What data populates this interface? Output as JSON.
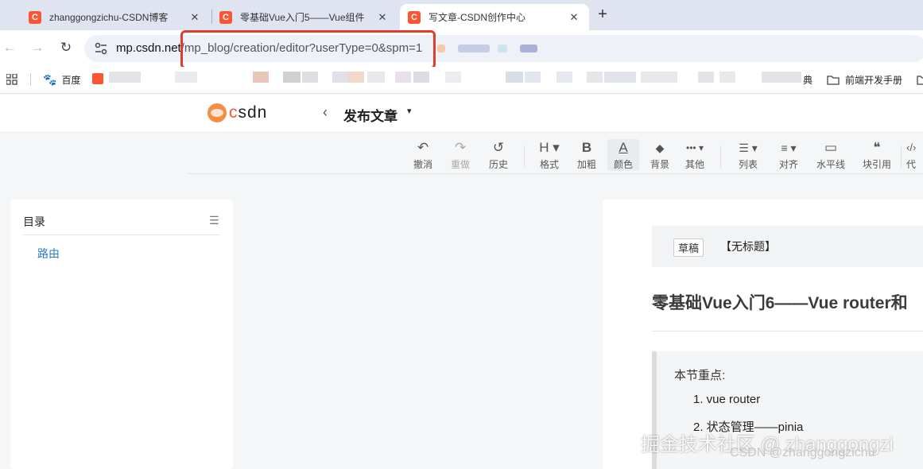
{
  "browser": {
    "tabs": [
      {
        "favicon": "C",
        "title": "zhanggongzichu-CSDN博客",
        "close": "✕"
      },
      {
        "favicon": "C",
        "title": "零基础Vue入门5——Vue组件",
        "close": "✕"
      },
      {
        "favicon": "C",
        "title": "写文章-CSDN创作中心",
        "close": "✕"
      }
    ],
    "new_tab": "+",
    "nav": {
      "back": "←",
      "forward": "→",
      "reload": "↻"
    },
    "url": {
      "host": "mp.csdn.net",
      "path": "/mp_blog/creation/editor?userType=0&spm=1"
    },
    "bookmarks": {
      "apps_icon": "apps-grid-icon",
      "baidu": "百度",
      "partial_item": "典",
      "folder_item": "前端开发手册"
    }
  },
  "header": {
    "logo_text": "CSDN",
    "back_symbol": "‹",
    "title": "发布文章",
    "caret": "▾"
  },
  "toolbar": [
    {
      "icon": "↶",
      "label": "撤消"
    },
    {
      "icon": "↷",
      "label": "重做"
    },
    {
      "icon": "↺",
      "label": "历史"
    },
    {
      "icon": "H ▾",
      "label": "格式"
    },
    {
      "icon": "B",
      "label": "加粗"
    },
    {
      "icon": "A",
      "label": "颜色"
    },
    {
      "icon": "◆",
      "label": "背景"
    },
    {
      "icon": "••• ▾",
      "label": "其他"
    },
    {
      "icon": "☰ ▾",
      "label": "列表"
    },
    {
      "icon": "≡ ▾",
      "label": "对齐"
    },
    {
      "icon": "▭",
      "label": "水平线"
    },
    {
      "icon": "❝",
      "label": "块引用"
    },
    {
      "icon": "‹/›",
      "label": "代"
    }
  ],
  "toc": {
    "title": "目录",
    "collapse_icon": "☰",
    "items": [
      "路由"
    ]
  },
  "doc": {
    "draft_badge": "草稿",
    "untitled": "【无标题】",
    "title": "零基础Vue入门6——Vue router和",
    "quote_title": "本节重点:",
    "quote_items": [
      "1. vue router",
      "2. 状态管理——pinia"
    ]
  },
  "watermarks": {
    "juejin": "掘金技术社区 @ zhanggongzi",
    "csdn": "CSDN @zhanggongzichu"
  },
  "colors": {
    "csdn_red": "#fc5531",
    "highlight_box": "#e03e2d",
    "link_blue": "#2d7ac6"
  }
}
